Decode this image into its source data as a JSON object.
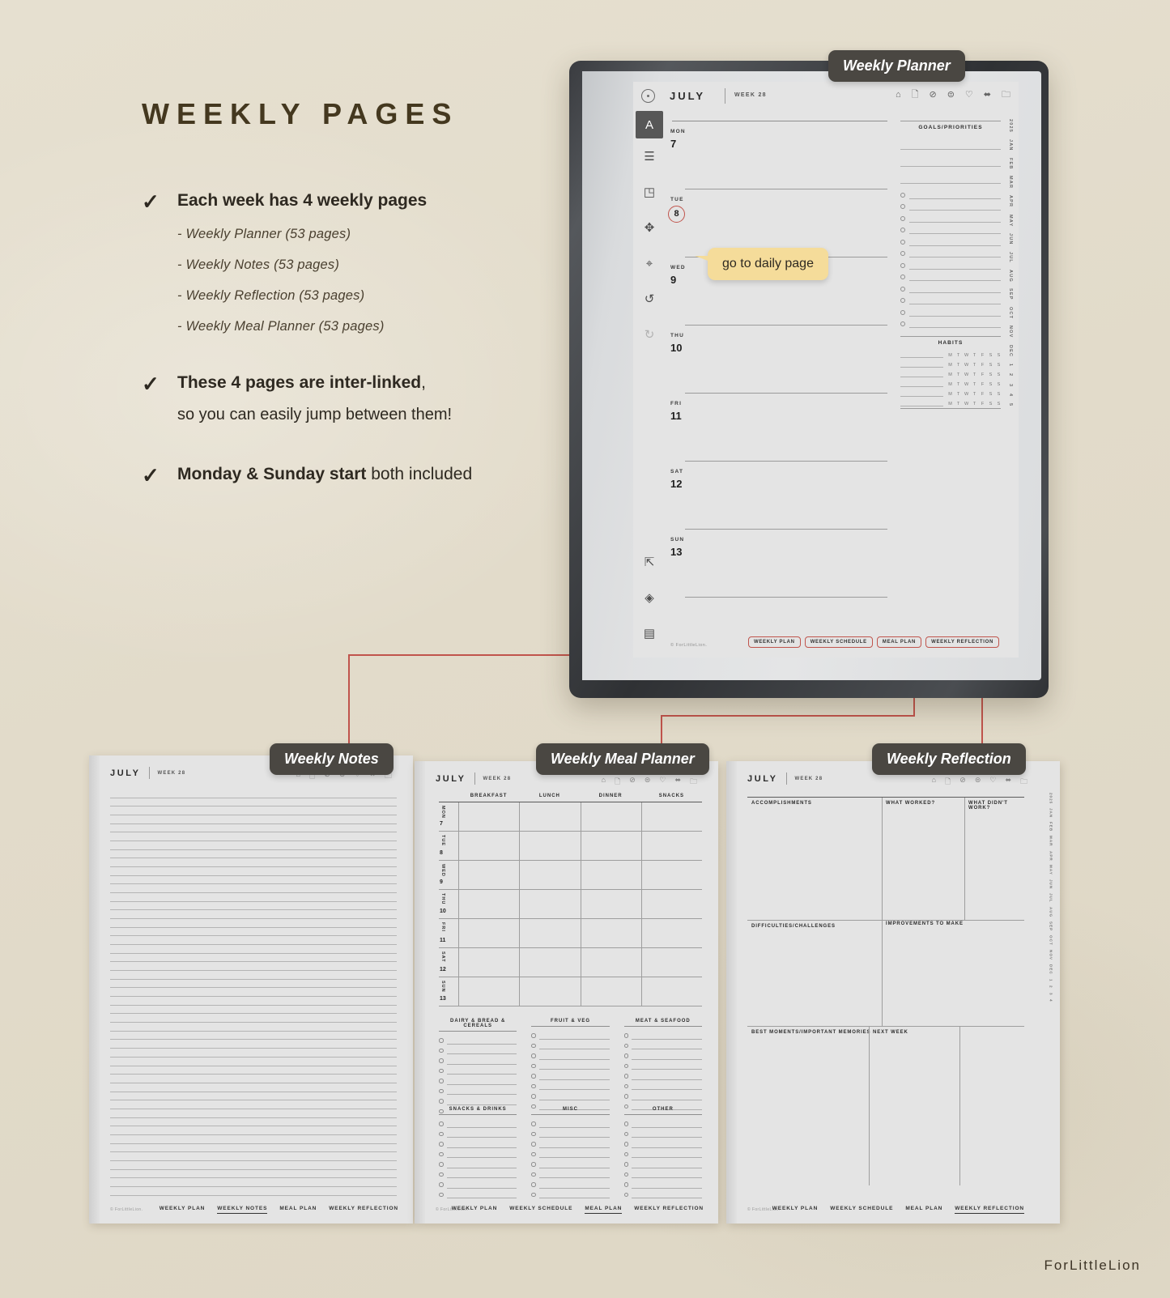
{
  "brand": "ForLittleLion",
  "headline": "WEEKLY PAGES",
  "bullets": [
    {
      "check": "✓",
      "head_bold": "Each week has 4 weekly pages",
      "head_light": "",
      "sub_items": [
        "- Weekly Planner (53 pages)",
        "- Weekly Notes (53 pages)",
        "- Weekly Reflection (53 pages)",
        "- Weekly Meal Planner (53 pages)"
      ],
      "sub_line": ""
    },
    {
      "check": "✓",
      "head_bold": "These 4 pages are inter-linked",
      "head_light": ",",
      "sub_items": [],
      "sub_line": "so you can easily jump between them!"
    },
    {
      "check": "✓",
      "head_bold": "Monday & Sunday start",
      "head_light": " both included",
      "sub_items": [],
      "sub_line": ""
    }
  ],
  "pills": {
    "weekly_planner": "Weekly Planner",
    "weekly_notes": "Weekly Notes",
    "weekly_meal_planner": "Weekly Meal Planner",
    "weekly_reflection": "Weekly Reflection"
  },
  "tooltip": "go to daily page",
  "planner": {
    "month": "JULY",
    "week": "WEEK 28",
    "header_icons": [
      "home-icon",
      "page-icon",
      "check-circle-icon",
      "dollar-circle-icon",
      "heart-icon",
      "arrows-icon",
      "briefcase-icon"
    ],
    "tools": [
      "pen-icon",
      "lines-icon",
      "eraser-icon",
      "move-icon",
      "zoom-icon",
      "undo-icon",
      "redo-icon"
    ],
    "tools_bottom": [
      "export-icon",
      "layers-icon",
      "notebook-icon"
    ],
    "days": [
      {
        "label": "MON",
        "num": "7"
      },
      {
        "label": "TUE",
        "num": "8"
      },
      {
        "label": "WED",
        "num": "9"
      },
      {
        "label": "THU",
        "num": "10"
      },
      {
        "label": "FRI",
        "num": "11"
      },
      {
        "label": "SAT",
        "num": "12"
      },
      {
        "label": "SUN",
        "num": "13"
      }
    ],
    "goals_title": "GOALS/PRIORITIES",
    "habits_title": "HABITS",
    "habit_days": [
      "M",
      "T",
      "W",
      "T",
      "F",
      "S",
      "S"
    ],
    "habit_rows": 6,
    "goal_rows": 12,
    "nav": [
      "WEEKLY PLAN",
      "WEEKLY SCHEDULE",
      "MEAL PLAN",
      "WEEKLY REFLECTION"
    ],
    "footer_brand": "© ForLittleLion.",
    "months_rail": [
      "2025",
      "JAN",
      "FEB",
      "MAR",
      "APR",
      "MAY",
      "JUN",
      "JUL",
      "AUG",
      "SEP",
      "OCT",
      "NOV",
      "DEC",
      "1",
      "2",
      "3",
      "4",
      "5"
    ]
  },
  "notes_page": {
    "month": "JULY",
    "week": "WEEK 28",
    "line_count": 47,
    "footer_brand": "© ForLittleLion.",
    "nav": [
      "WEEKLY PLAN",
      "WEEKLY NOTES",
      "MEAL PLAN",
      "WEEKLY REFLECTION"
    ],
    "active_nav": "WEEKLY NOTES"
  },
  "meal_page": {
    "month": "JULY",
    "week": "WEEK 28",
    "columns": [
      "BREAKFAST",
      "LUNCH",
      "DINNER",
      "SNACKS"
    ],
    "days": [
      {
        "label": "MON",
        "num": "7"
      },
      {
        "label": "TUE",
        "num": "8"
      },
      {
        "label": "WED",
        "num": "9"
      },
      {
        "label": "THU",
        "num": "10"
      },
      {
        "label": "FRI",
        "num": "11"
      },
      {
        "label": "SAT",
        "num": "12"
      },
      {
        "label": "SUN",
        "num": "13"
      }
    ],
    "shopping_rows": [
      [
        "DAIRY & BREAD & CEREALS",
        "FRUIT & VEG",
        "MEAT & SEAFOOD"
      ],
      [
        "SNACKS & DRINKS",
        "MISC",
        "OTHER"
      ]
    ],
    "shopping_item_count": 8,
    "footer_brand": "© ForLittleLion.",
    "nav": [
      "WEEKLY PLAN",
      "WEEKLY SCHEDULE",
      "MEAL PLAN",
      "WEEKLY REFLECTION"
    ],
    "active_nav": "MEAL PLAN"
  },
  "reflection_page": {
    "month": "JULY",
    "week": "WEEK 28",
    "sections": {
      "accomplishments": "ACCOMPLISHMENTS",
      "what_worked": "WHAT WORKED?",
      "what_didnt_work": "WHAT DIDN'T WORK?",
      "difficulties": "DIFFICULTIES/CHALLENGES",
      "improvements": "IMPROVEMENTS TO MAKE",
      "best_moments": "BEST MOMENTS/IMPORTANT MEMORIES",
      "next_week": "NEXT WEEK"
    },
    "footer_brand": "© ForLittleLion.",
    "nav": [
      "WEEKLY PLAN",
      "WEEKLY SCHEDULE",
      "MEAL PLAN",
      "WEEKLY REFLECTION"
    ],
    "active_nav": "WEEKLY REFLECTION",
    "months_rail": [
      "2025",
      "JAN",
      "FEB",
      "MAR",
      "APR",
      "MAY",
      "JUN",
      "JUL",
      "AUG",
      "SEP",
      "OCT",
      "NOV",
      "DEC",
      "1",
      "2",
      "3",
      "4"
    ]
  },
  "colors": {
    "background": "#e3ddcd",
    "accent_red": "#c0544c",
    "pill_dark": "#4a4742",
    "tooltip_yellow": "#f5dc9a",
    "text_dark": "#2e2921"
  }
}
